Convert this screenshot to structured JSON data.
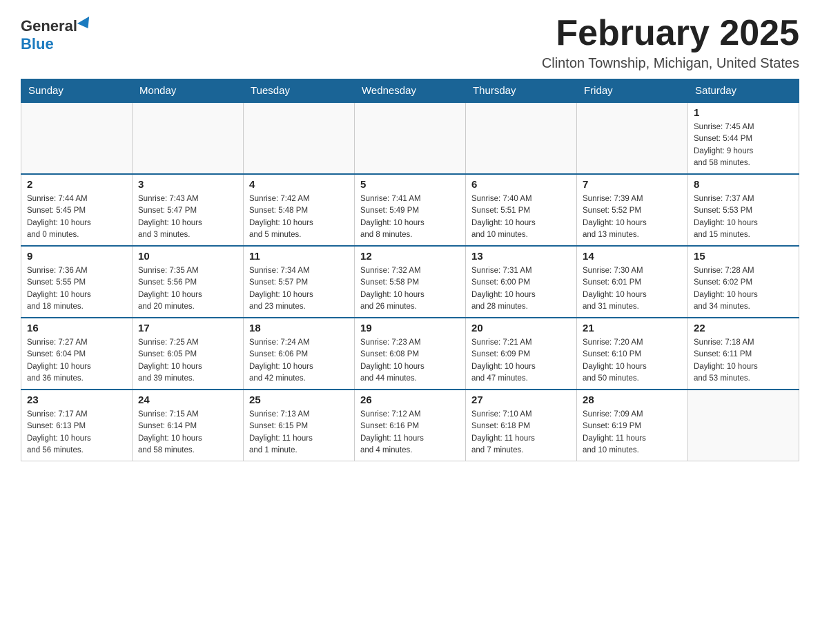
{
  "logo": {
    "general": "General",
    "blue": "Blue"
  },
  "title": "February 2025",
  "location": "Clinton Township, Michigan, United States",
  "days_of_week": [
    "Sunday",
    "Monday",
    "Tuesday",
    "Wednesday",
    "Thursday",
    "Friday",
    "Saturday"
  ],
  "weeks": [
    [
      {
        "day": "",
        "info": ""
      },
      {
        "day": "",
        "info": ""
      },
      {
        "day": "",
        "info": ""
      },
      {
        "day": "",
        "info": ""
      },
      {
        "day": "",
        "info": ""
      },
      {
        "day": "",
        "info": ""
      },
      {
        "day": "1",
        "info": "Sunrise: 7:45 AM\nSunset: 5:44 PM\nDaylight: 9 hours\nand 58 minutes."
      }
    ],
    [
      {
        "day": "2",
        "info": "Sunrise: 7:44 AM\nSunset: 5:45 PM\nDaylight: 10 hours\nand 0 minutes."
      },
      {
        "day": "3",
        "info": "Sunrise: 7:43 AM\nSunset: 5:47 PM\nDaylight: 10 hours\nand 3 minutes."
      },
      {
        "day": "4",
        "info": "Sunrise: 7:42 AM\nSunset: 5:48 PM\nDaylight: 10 hours\nand 5 minutes."
      },
      {
        "day": "5",
        "info": "Sunrise: 7:41 AM\nSunset: 5:49 PM\nDaylight: 10 hours\nand 8 minutes."
      },
      {
        "day": "6",
        "info": "Sunrise: 7:40 AM\nSunset: 5:51 PM\nDaylight: 10 hours\nand 10 minutes."
      },
      {
        "day": "7",
        "info": "Sunrise: 7:39 AM\nSunset: 5:52 PM\nDaylight: 10 hours\nand 13 minutes."
      },
      {
        "day": "8",
        "info": "Sunrise: 7:37 AM\nSunset: 5:53 PM\nDaylight: 10 hours\nand 15 minutes."
      }
    ],
    [
      {
        "day": "9",
        "info": "Sunrise: 7:36 AM\nSunset: 5:55 PM\nDaylight: 10 hours\nand 18 minutes."
      },
      {
        "day": "10",
        "info": "Sunrise: 7:35 AM\nSunset: 5:56 PM\nDaylight: 10 hours\nand 20 minutes."
      },
      {
        "day": "11",
        "info": "Sunrise: 7:34 AM\nSunset: 5:57 PM\nDaylight: 10 hours\nand 23 minutes."
      },
      {
        "day": "12",
        "info": "Sunrise: 7:32 AM\nSunset: 5:58 PM\nDaylight: 10 hours\nand 26 minutes."
      },
      {
        "day": "13",
        "info": "Sunrise: 7:31 AM\nSunset: 6:00 PM\nDaylight: 10 hours\nand 28 minutes."
      },
      {
        "day": "14",
        "info": "Sunrise: 7:30 AM\nSunset: 6:01 PM\nDaylight: 10 hours\nand 31 minutes."
      },
      {
        "day": "15",
        "info": "Sunrise: 7:28 AM\nSunset: 6:02 PM\nDaylight: 10 hours\nand 34 minutes."
      }
    ],
    [
      {
        "day": "16",
        "info": "Sunrise: 7:27 AM\nSunset: 6:04 PM\nDaylight: 10 hours\nand 36 minutes."
      },
      {
        "day": "17",
        "info": "Sunrise: 7:25 AM\nSunset: 6:05 PM\nDaylight: 10 hours\nand 39 minutes."
      },
      {
        "day": "18",
        "info": "Sunrise: 7:24 AM\nSunset: 6:06 PM\nDaylight: 10 hours\nand 42 minutes."
      },
      {
        "day": "19",
        "info": "Sunrise: 7:23 AM\nSunset: 6:08 PM\nDaylight: 10 hours\nand 44 minutes."
      },
      {
        "day": "20",
        "info": "Sunrise: 7:21 AM\nSunset: 6:09 PM\nDaylight: 10 hours\nand 47 minutes."
      },
      {
        "day": "21",
        "info": "Sunrise: 7:20 AM\nSunset: 6:10 PM\nDaylight: 10 hours\nand 50 minutes."
      },
      {
        "day": "22",
        "info": "Sunrise: 7:18 AM\nSunset: 6:11 PM\nDaylight: 10 hours\nand 53 minutes."
      }
    ],
    [
      {
        "day": "23",
        "info": "Sunrise: 7:17 AM\nSunset: 6:13 PM\nDaylight: 10 hours\nand 56 minutes."
      },
      {
        "day": "24",
        "info": "Sunrise: 7:15 AM\nSunset: 6:14 PM\nDaylight: 10 hours\nand 58 minutes."
      },
      {
        "day": "25",
        "info": "Sunrise: 7:13 AM\nSunset: 6:15 PM\nDaylight: 11 hours\nand 1 minute."
      },
      {
        "day": "26",
        "info": "Sunrise: 7:12 AM\nSunset: 6:16 PM\nDaylight: 11 hours\nand 4 minutes."
      },
      {
        "day": "27",
        "info": "Sunrise: 7:10 AM\nSunset: 6:18 PM\nDaylight: 11 hours\nand 7 minutes."
      },
      {
        "day": "28",
        "info": "Sunrise: 7:09 AM\nSunset: 6:19 PM\nDaylight: 11 hours\nand 10 minutes."
      },
      {
        "day": "",
        "info": ""
      }
    ]
  ]
}
